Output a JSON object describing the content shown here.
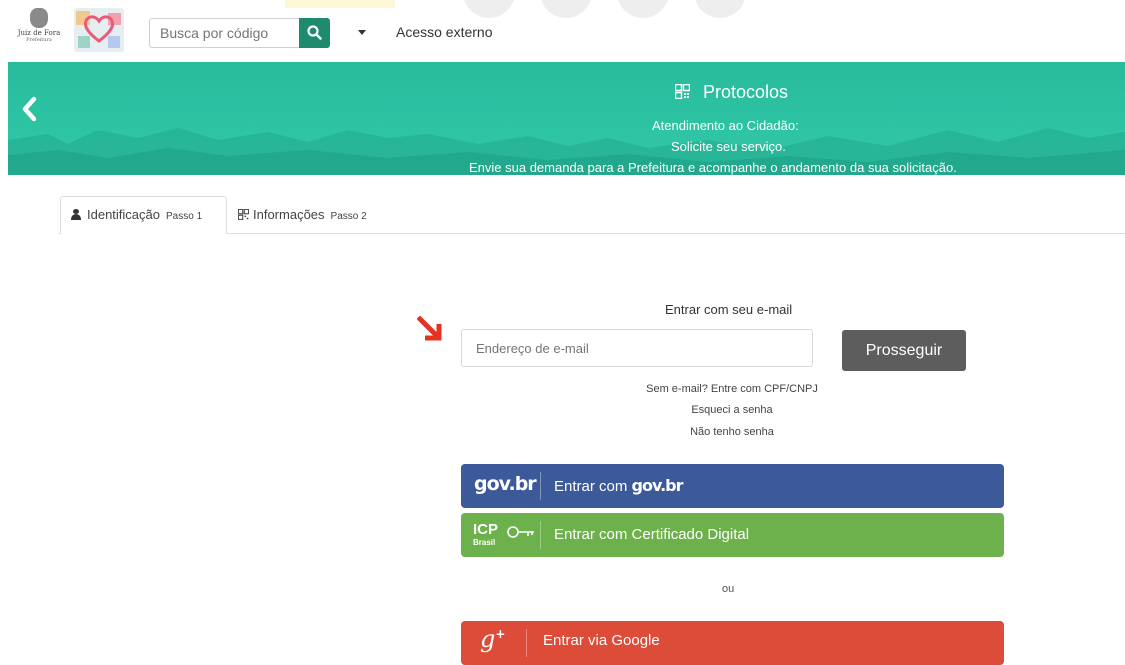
{
  "header": {
    "logo_city_line1": "Juiz de Fora",
    "logo_city_line2": "Prefeitura",
    "search_placeholder": "Busca por código",
    "external_access_label": "Acesso externo"
  },
  "banner": {
    "title": "Protocolos",
    "line1": "Atendimento ao Cidadão:",
    "line2": "Solicite seu serviço.",
    "line3": "Envie sua demanda para a Prefeitura e acompanhe o andamento da sua solicitação."
  },
  "tabs": [
    {
      "label": "Identificação",
      "step": "Passo 1",
      "active": true
    },
    {
      "label": "Informações",
      "step": "Passo 2",
      "active": false
    }
  ],
  "login": {
    "title": "Entrar com seu e-mail",
    "email_placeholder": "Endereço de e-mail",
    "submit_label": "Prosseguir",
    "link_cpf": "Sem e-mail? Entre com CPF/CNPJ",
    "link_forgot": "Esqueci a senha",
    "link_no_password": "Não tenho senha",
    "or_label": "ou"
  },
  "sso": {
    "govbr_logo": "gov.br",
    "govbr_prefix": "Entrar com",
    "govbr_brand": "gov.br",
    "icp_logo_line1": "ICP",
    "icp_logo_line2": "Brasil",
    "icp_label": "Entrar com Certificado Digital",
    "google_logo": "g",
    "google_logo_plus": "+",
    "google_label": "Entrar via Google"
  },
  "icons": {
    "search": "search-icon",
    "back": "chevron-left-icon",
    "protocol": "qr-grid-icon",
    "person": "user-icon",
    "pointer": "red-arrow-icon"
  },
  "colors": {
    "banner": "#2cc3a3",
    "search_button": "#1f8b6e",
    "submit": "#5d5d5d",
    "govbr": "#3c5a9a",
    "icp": "#6cb14b",
    "google": "#dd4b39"
  }
}
